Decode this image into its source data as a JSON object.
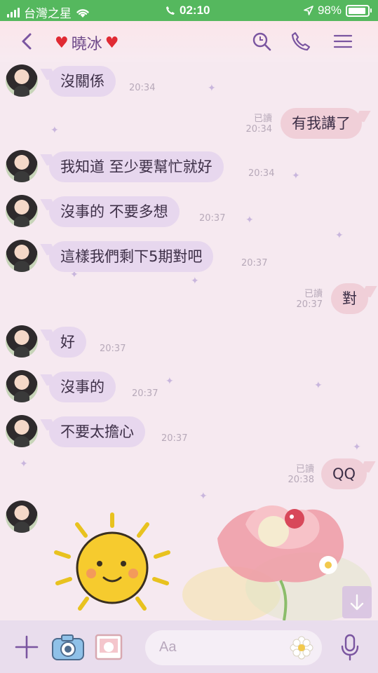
{
  "status_bar": {
    "carrier": "台灣之星",
    "time": "02:10",
    "battery": "98%"
  },
  "header": {
    "contact_name": "曉冰"
  },
  "messages": [
    {
      "side": "left",
      "text": "沒關係",
      "time": "20:34"
    },
    {
      "side": "right",
      "text": "有我講了",
      "read": "已讀",
      "time": "20:34"
    },
    {
      "side": "left",
      "text": "我知道 至少要幫忙就好",
      "time": "20:34"
    },
    {
      "side": "left",
      "text": "沒事的 不要多想",
      "time": "20:37"
    },
    {
      "side": "left",
      "text": "這樣我們剩下5期對吧",
      "time": "20:37"
    },
    {
      "side": "right",
      "text": "對",
      "read": "已讀",
      "time": "20:37"
    },
    {
      "side": "left",
      "text": "好",
      "time": "20:37"
    },
    {
      "side": "left",
      "text": "沒事的",
      "time": "20:37"
    },
    {
      "side": "left",
      "text": "不要太擔心",
      "time": "20:37"
    },
    {
      "side": "right",
      "text": "QQ",
      "read": "已讀",
      "time": "20:38"
    }
  ],
  "input": {
    "placeholder": "Aa"
  },
  "colors": {
    "status_bar": "#55b85e",
    "accent": "#6f4a8a",
    "left_bubble": "#e7d7ee",
    "right_bubble": "#f0cfd8"
  }
}
